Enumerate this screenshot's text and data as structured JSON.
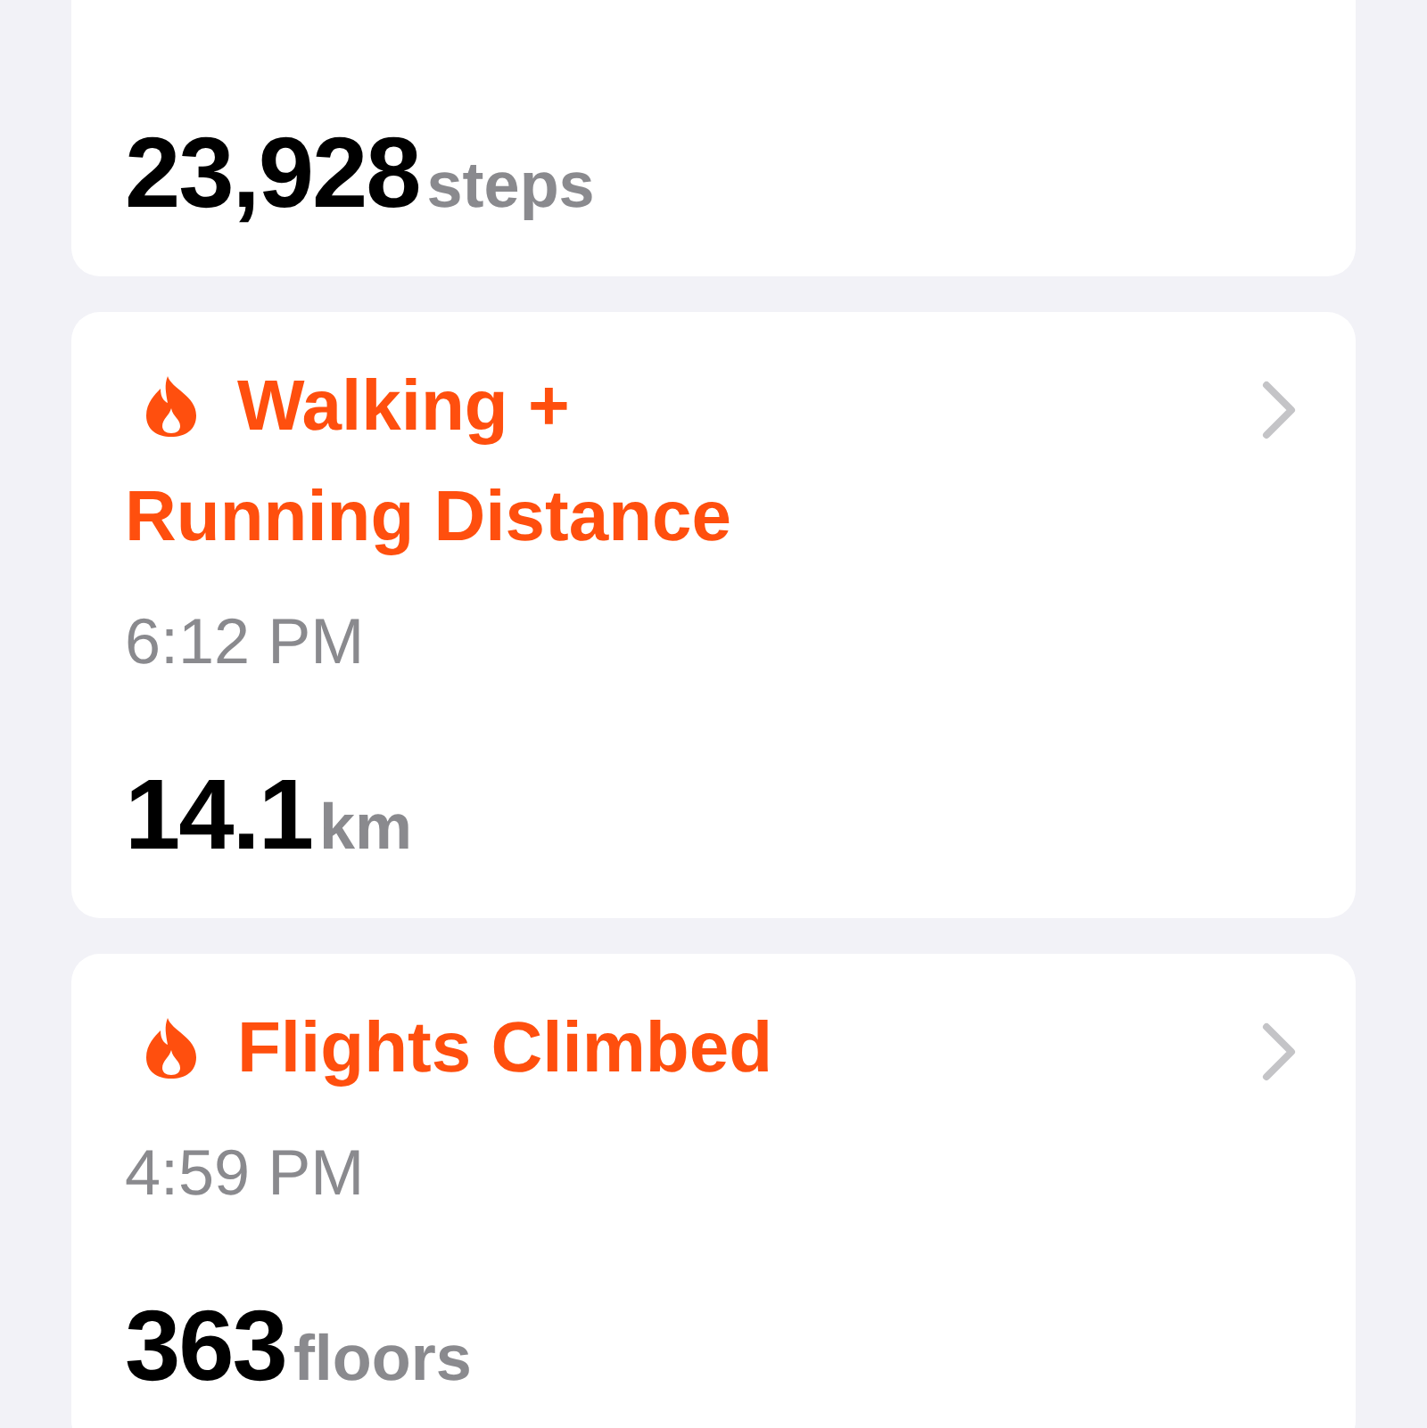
{
  "cards": [
    {
      "value": "23,928",
      "unit": "steps"
    },
    {
      "title_lines": [
        "Walking +",
        "Running Distance"
      ],
      "time": "6:12 PM",
      "value": "14.1",
      "unit": "km"
    },
    {
      "title_lines": [
        "Flights Climbed"
      ],
      "time": "4:59 PM",
      "value": "363",
      "unit": "floors"
    }
  ]
}
